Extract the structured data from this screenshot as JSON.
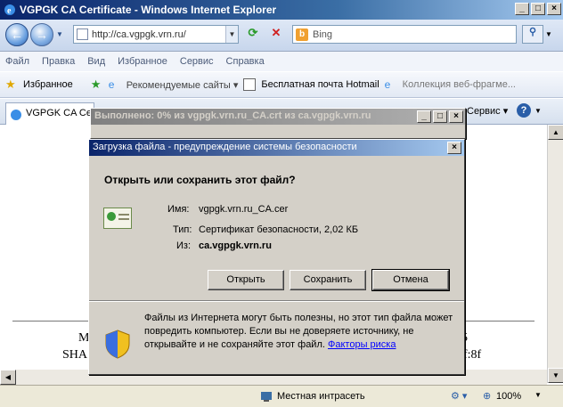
{
  "window": {
    "title": "VGPGK CA Certificate - Windows Internet Explorer",
    "min": "_",
    "max": "□",
    "close": "×"
  },
  "nav": {
    "back": "←",
    "forward": "→",
    "url": "http://ca.vgpgk.vrn.ru/",
    "search_placeholder": "Bing"
  },
  "menu": [
    "Файл",
    "Правка",
    "Вид",
    "Избранное",
    "Сервис",
    "Справка"
  ],
  "favorites": {
    "label": "Избранное",
    "items": [
      "Рекомендуемые сайты ▾",
      "Бесплатная почта Hotmail",
      "Коллекция веб-фрагме..."
    ]
  },
  "tab": {
    "title": "VGPGK CA Certi",
    "tools": "Сервис ▾",
    "help": "?"
  },
  "page": {
    "line1_left": "M",
    "line1_right": "5",
    "line2_left": "SHA",
    "line2_right": "f:8f"
  },
  "progress_dialog": {
    "title": "Выполнено: 0% из vgpgk.vrn.ru_CA.crt из ca.vgpgk.vrn.ru"
  },
  "download_dialog": {
    "title": "Загрузка файла - предупреждение системы безопасности",
    "question": "Открыть или сохранить этот файл?",
    "name_label": "Имя:",
    "name_value": "vgpgk.vrn.ru_CA.cer",
    "type_label": "Тип:",
    "type_value": "Сертификат безопасности, 2,02 КБ",
    "from_label": "Из:",
    "from_value": "ca.vgpgk.vrn.ru",
    "open": "Открыть",
    "save": "Сохранить",
    "cancel": "Отмена",
    "warning": "Файлы из Интернета могут быть полезны, но этот тип файла может повредить компьютер. Если вы не доверяете источнику, не открывайте и не сохраняйте этот файл.",
    "risk_link": "Факторы риска"
  },
  "status": {
    "zone": "Местная интрасеть",
    "zoom": "100%"
  },
  "colors": {
    "accent": "#0a246a",
    "link": "#0000ff",
    "dialog": "#d4d0c8"
  }
}
